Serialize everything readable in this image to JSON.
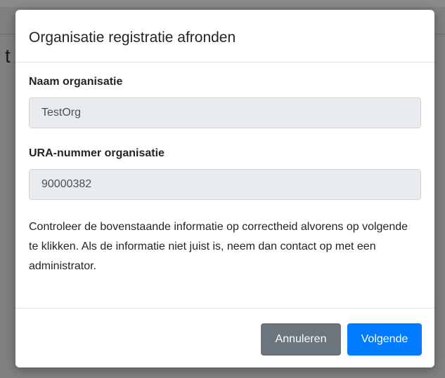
{
  "background": {
    "partial_heading": "t"
  },
  "modal": {
    "title": "Organisatie registratie afronden",
    "fields": {
      "name": {
        "label": "Naam organisatie",
        "value": "TestOrg"
      },
      "ura": {
        "label": "URA-nummer organisatie",
        "value": "90000382"
      }
    },
    "info_text": "Controleer de bovenstaande informatie op correctheid alvorens op volgende te klikken. Als de informatie niet juist is, neem dan contact op met een administrator.",
    "buttons": {
      "cancel_label": "Annuleren",
      "next_label": "Volgende"
    }
  },
  "colors": {
    "primary": "#007bff",
    "secondary": "#6c757d",
    "input_bg": "#e9ecef"
  }
}
